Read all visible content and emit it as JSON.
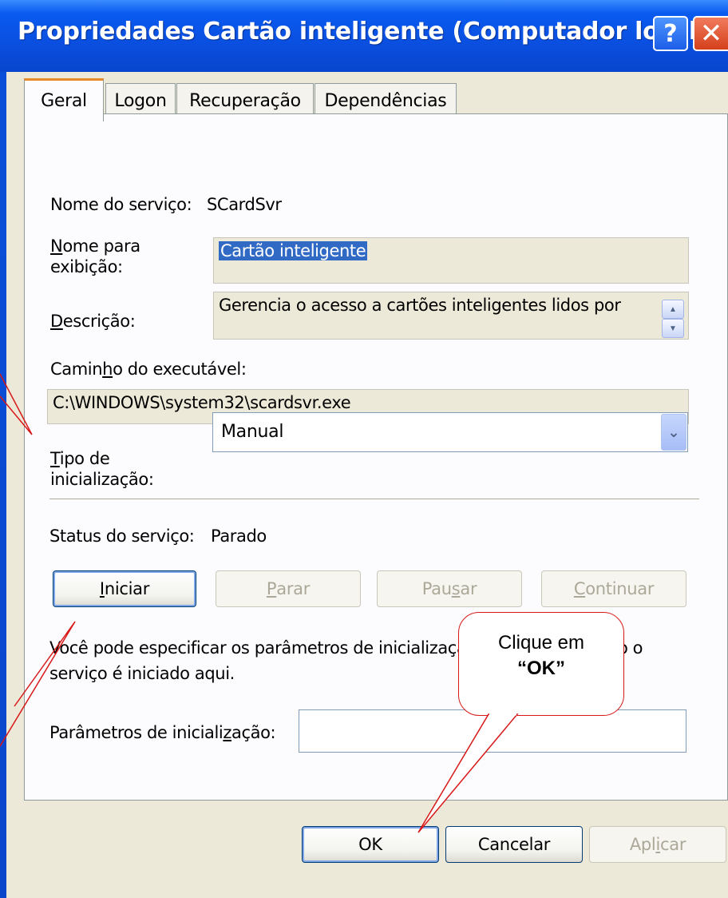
{
  "window": {
    "title": "Propriedades Cartão inteligente (Computador local)",
    "help_glyph": "?",
    "close_glyph": "✕"
  },
  "tabs": [
    {
      "label": "Geral"
    },
    {
      "label": "Logon"
    },
    {
      "label": "Recuperação"
    },
    {
      "label": "Dependências"
    }
  ],
  "general": {
    "service_name_label": "Nome do serviço:",
    "service_name_value": "SCardSvr",
    "display_name_label_1": "N",
    "display_name_label_2": "ome para",
    "display_name_label_3": "exibição:",
    "display_name_value": "Cartão inteligente",
    "description_label_1": "D",
    "description_label_2": "escrição:",
    "description_value": "Gerencia o acesso a cartões inteligentes lidos por",
    "exec_path_label_1": "Camin",
    "exec_path_label_2": "h",
    "exec_path_label_3": "o do executável:",
    "exec_path_value": "C:\\WINDOWS\\system32\\scardsvr.exe",
    "startup_type_label_1": "T",
    "startup_type_label_2": "ipo de",
    "startup_type_label_3": "inicialização:",
    "startup_type_value": "Manual",
    "status_label": "Status do serviço:",
    "status_value": "Parado",
    "info_line_1": "Você pode especificar os parâmetros de inicialização aplicáveis quando o",
    "info_line_2": "serviço é iniciado aqui.",
    "start_params_label_1": "Parâmetros de iniciali",
    "start_params_label_2": "z",
    "start_params_label_3": "ação:",
    "start_params_value": ""
  },
  "service_buttons": {
    "start_1": "I",
    "start_2": "niciar",
    "stop_1": "P",
    "stop_2": "arar",
    "pause_1": "Pau",
    "pause_2": "s",
    "pause_3": "ar",
    "continue_1": "C",
    "continue_2": "ontinuar"
  },
  "dialog_buttons": {
    "ok": "OK",
    "cancel": "Cancelar",
    "apply_1": "Apl",
    "apply_2": "i",
    "apply_3": "car"
  },
  "callout": {
    "line1": "Clique em",
    "line2": "“OK”"
  },
  "colors": {
    "titlebar": "#0a5bf0",
    "active_tab_accent": "#e68b2c",
    "callout_border": "#d81818",
    "selection": "#316ac5"
  }
}
